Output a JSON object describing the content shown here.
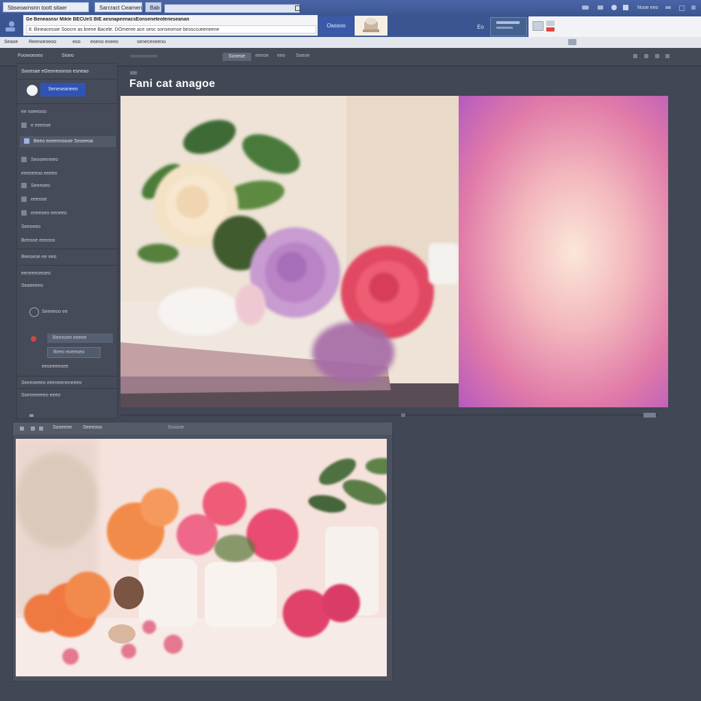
{
  "browser": {
    "tabs": [
      "Sbseoarnsnn   toott   sitaer",
      "Sarcract Ceamena",
      "Bab"
    ],
    "address_lines": [
      "Ge Beneasnsr Mikle BECUeS BIE aesnapeenacsEonseneteoteneseanan",
      "8. Bineacessie Soocm as brene Bacele. DOmeree ace sesc sonseomse bessccueeneene"
    ],
    "header_button": "Oassoo",
    "right_label": "Eo"
  },
  "toolbar_right": [
    "Nuoe eeo"
  ],
  "statusbar": {
    "items": [
      "Seaoe",
      "Reenoeneoo",
      "eoo",
      "eoeno eoeeo",
      "seneceneeno"
    ]
  },
  "appbar": {
    "left_label": "Foowoeoeo",
    "left_label2": "Sioeo",
    "field": "Soneoe",
    "crumbs": [
      "eenoe",
      "eeo",
      "Soeoe"
    ]
  },
  "sidebar": {
    "header": "Sooesae eGeoneoonso esneao",
    "primary_button": "Seneseaneeo",
    "rows": [
      "ee noeeooo",
      "e eeenoe",
      "Beeo eoeennoooe Seseeoa",
      "Seooeeneeo",
      "eeeoeeoo eeeeo",
      "Seeeoeo",
      "eeeooe",
      "eoeeoeo eeneeo",
      "Seeoeeo",
      "Beeooe eeeono",
      "Beeoeoe ee eeo",
      "eeneeeoeoeo",
      "Seaeeeeo",
      "Seeeeoo  ee",
      "Beeeoee  eeeee",
      "Beeo eoeeoeo",
      "eeoeeeeoee",
      "Seeeoeeeo eeeneeneneeeo",
      "Soeneeeeeo eeeo"
    ]
  },
  "main": {
    "heading": "Fani cat anagoe"
  },
  "bottom_window": {
    "tab_labels": [
      "Sooeeoe",
      "Seeeooo",
      "Sosooe"
    ]
  },
  "colors": {
    "titlebar": "#4a65a6",
    "workspace": "#414754",
    "accent_button": "#2f54b5",
    "gradient_pink": "#e07aa8",
    "gradient_purple": "#b55ac0"
  }
}
